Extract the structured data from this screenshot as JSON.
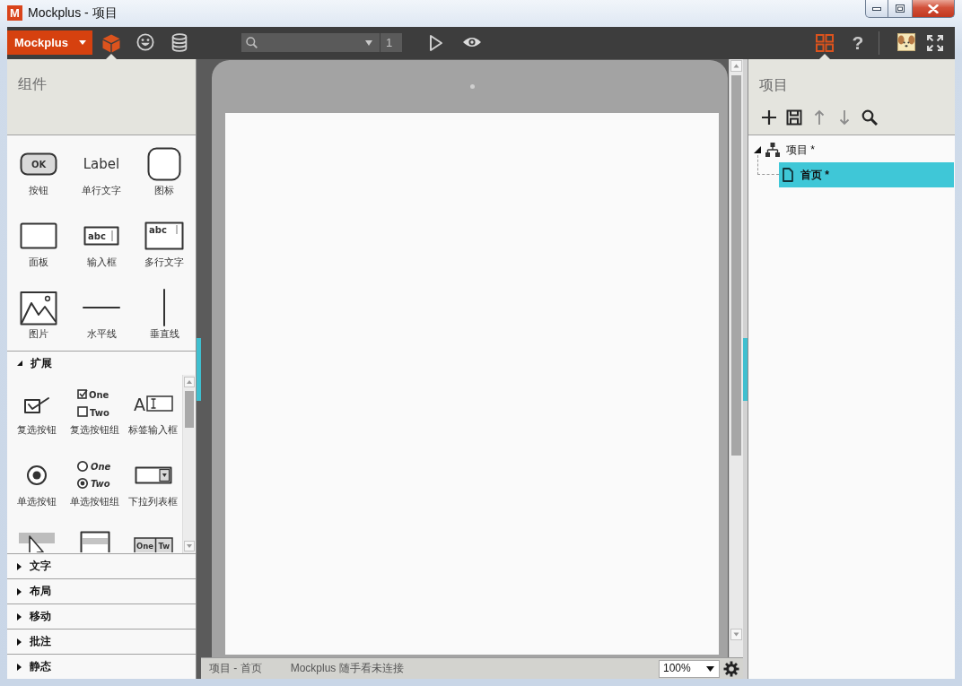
{
  "window": {
    "icon_letter": "M",
    "title": "Mockplus - 项目"
  },
  "toolbar": {
    "brand": "Mockplus",
    "mode_tabs": [
      {
        "kind": "cube",
        "selected": true
      },
      {
        "kind": "smiley",
        "selected": false
      },
      {
        "kind": "database",
        "selected": false
      }
    ],
    "page_number": "1",
    "view_tabs": [
      {
        "kind": "grid",
        "selected": true
      }
    ],
    "help": "?"
  },
  "components_panel": {
    "title": "组件",
    "items": [
      {
        "label": "按钮",
        "kind": "button",
        "icon_text": [
          "OK"
        ]
      },
      {
        "label": "单行文字",
        "kind": "label",
        "icon_text": [
          "Label"
        ]
      },
      {
        "label": "图标",
        "kind": "icon"
      },
      {
        "label": "面板",
        "kind": "panel"
      },
      {
        "label": "输入框",
        "kind": "input",
        "icon_text": [
          "abc"
        ]
      },
      {
        "label": "多行文字",
        "kind": "textarea",
        "icon_text": [
          "abc"
        ]
      },
      {
        "label": "图片",
        "kind": "image"
      },
      {
        "label": "水平线",
        "kind": "hline"
      },
      {
        "label": "垂直线",
        "kind": "vline"
      }
    ],
    "sections": [
      {
        "label": "扩展",
        "expanded": true,
        "items": [
          {
            "label": "复选按钮",
            "kind": "checkbox"
          },
          {
            "label": "复选按钮组",
            "kind": "checkbox_group",
            "icon_text": [
              "One",
              "Two"
            ]
          },
          {
            "label": "标签输入框",
            "kind": "label_input",
            "icon_text": [
              "A"
            ]
          },
          {
            "label": "单选按钮",
            "kind": "radio"
          },
          {
            "label": "单选按钮组",
            "kind": "radio_group",
            "icon_text": [
              "One",
              "Two"
            ]
          },
          {
            "label": "下拉列表框",
            "kind": "dropdown"
          },
          {
            "kind": "menu"
          },
          {
            "kind": "panel_bar"
          },
          {
            "kind": "tabs",
            "icon_text": [
              "One",
              "Tw"
            ]
          }
        ]
      },
      {
        "label": "文字",
        "expanded": false
      },
      {
        "label": "布局",
        "expanded": false
      },
      {
        "label": "移动",
        "expanded": false
      },
      {
        "label": "批注",
        "expanded": false
      },
      {
        "label": "静态",
        "expanded": false
      }
    ]
  },
  "status_bar": {
    "breadcrumb": "项目 - 首页",
    "connection": "Mockplus 随手看未连接",
    "zoom": "100%"
  },
  "project_panel": {
    "title": "项目",
    "tools": [
      {
        "kind": "add",
        "disabled": false
      },
      {
        "kind": "save",
        "disabled": false
      },
      {
        "kind": "up",
        "disabled": true
      },
      {
        "kind": "down",
        "disabled": true
      },
      {
        "kind": "search",
        "disabled": false
      }
    ],
    "tree": [
      {
        "label": "项目 *",
        "kind": "project",
        "expanded": true,
        "selected": false,
        "children": [
          {
            "label": "首页 *",
            "kind": "page",
            "selected": true
          }
        ]
      }
    ]
  }
}
